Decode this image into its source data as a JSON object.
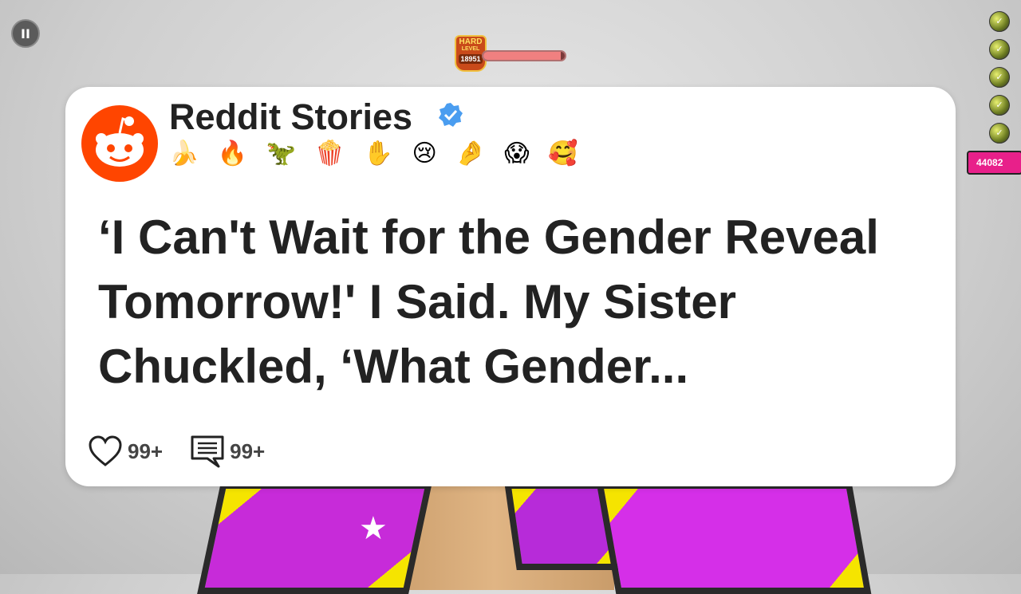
{
  "hud": {
    "pause_symbol": "II",
    "difficulty": "HARD",
    "level_label": "LEVEL",
    "level_number": "18951",
    "progress": 0.95,
    "score": "44082"
  },
  "side_balls": [
    "✓",
    "✓",
    "✓",
    "✓",
    "✓"
  ],
  "post": {
    "channel_name": "Reddit Stories",
    "verified": true,
    "emojis": [
      "🍌",
      "🔥",
      "🦖",
      "🍿",
      "✋",
      "😢",
      "🤌",
      "😱",
      "🥰"
    ],
    "headline": "‘I Can't Wait for the Gender Reveal Tomorrow!' I Said. My Sister Chuckled, ‘What Gender...",
    "likes": "99+",
    "comments": "99+"
  },
  "colors": {
    "reddit_orange": "#ff4500",
    "verified_blue": "#4a9df0",
    "text": "#222222"
  }
}
